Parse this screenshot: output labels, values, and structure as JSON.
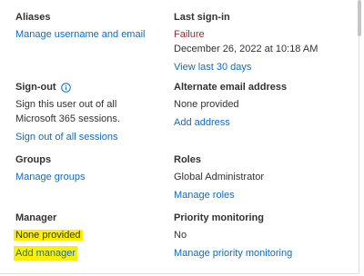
{
  "aliases": {
    "heading": "Aliases",
    "manage_link": "Manage username and email"
  },
  "last_sign_in": {
    "heading": "Last sign-in",
    "status": "Failure",
    "timestamp": "December 26, 2022 at 10:18 AM",
    "view_link": "View last 30 days"
  },
  "sign_out": {
    "heading": "Sign-out",
    "description_line1": "Sign this user out of all",
    "description_line2": "Microsoft 365 sessions.",
    "action_link": "Sign out of all sessions",
    "icon": "info-icon"
  },
  "alternate_email": {
    "heading": "Alternate email address",
    "value": "None provided",
    "add_link": "Add address"
  },
  "groups": {
    "heading": "Groups",
    "manage_link": "Manage groups"
  },
  "roles": {
    "heading": "Roles",
    "value": "Global Administrator",
    "manage_link": "Manage roles"
  },
  "manager": {
    "heading": "Manager",
    "value": "None provided",
    "add_link": "Add manager",
    "highlight_color": "#fff000"
  },
  "priority_monitoring": {
    "heading": "Priority monitoring",
    "value": "No",
    "manage_link": "Manage priority monitoring"
  },
  "colors": {
    "link": "#0f6cbd",
    "failure": "#a4262c",
    "text": "#323130"
  }
}
